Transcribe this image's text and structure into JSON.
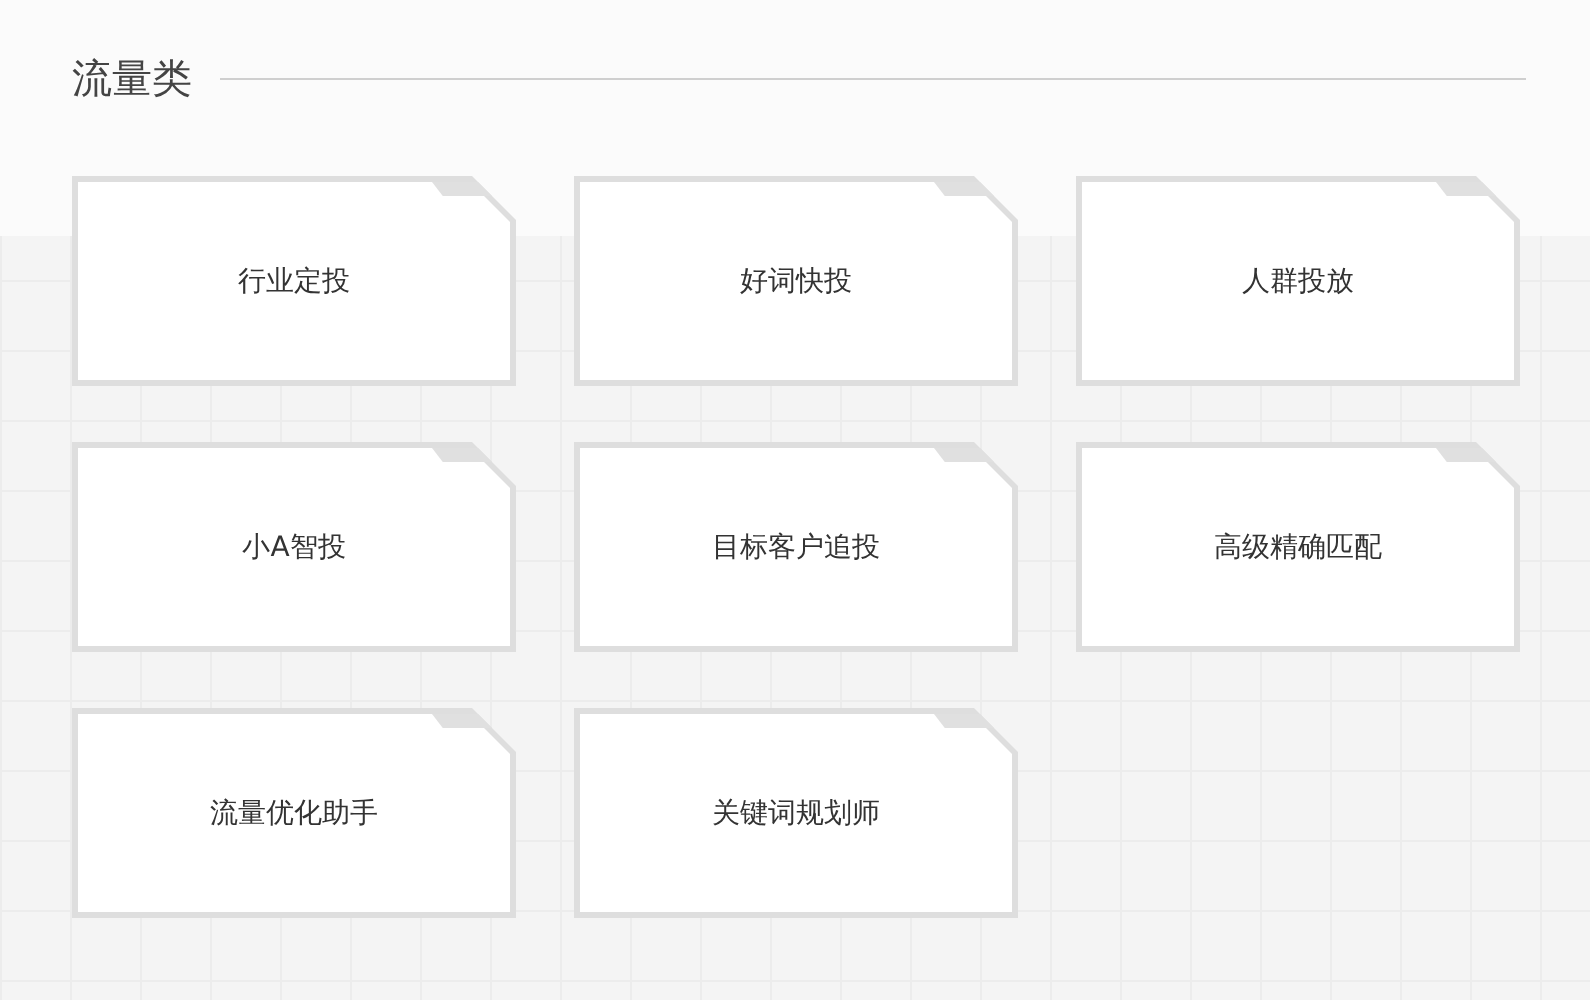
{
  "section": {
    "title": "流量类"
  },
  "cards": [
    {
      "label": "行业定投"
    },
    {
      "label": "好词快投"
    },
    {
      "label": "人群投放"
    },
    {
      "label": "小A智投"
    },
    {
      "label": "目标客户追投"
    },
    {
      "label": "高级精确匹配"
    },
    {
      "label": "流量优化助手"
    },
    {
      "label": "关键词规划师"
    }
  ]
}
